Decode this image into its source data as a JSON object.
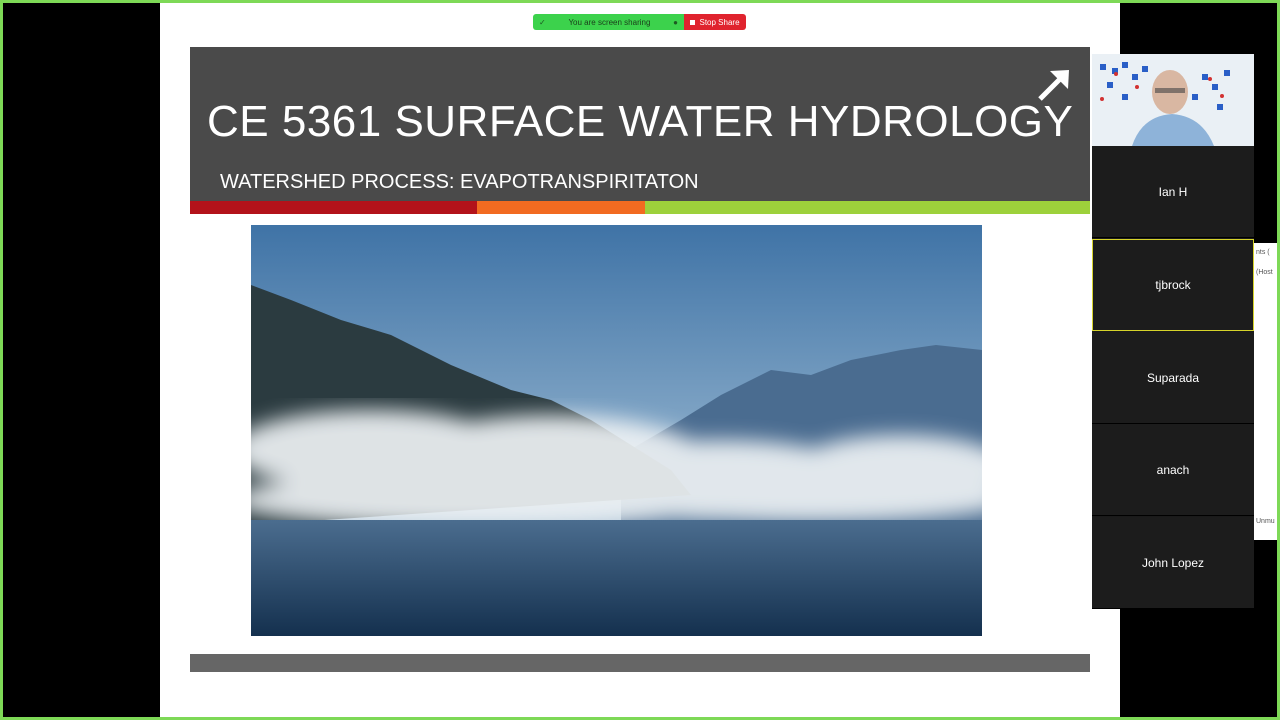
{
  "share_bar": {
    "status_text": "You are screen sharing",
    "stop_label": "Stop Share",
    "status_color": "#3cd24c",
    "stop_color": "#e0232e"
  },
  "slide": {
    "title": "CE 5361 SURFACE WATER HYDROLOGY",
    "subtitle": "WATERSHED PROCESS: EVAPOTRANSPIRITATON",
    "title_bg": "#4a4a4a",
    "accent_colors": [
      "#b3121a",
      "#f26b21",
      "#9dd13b"
    ],
    "photo_alt": "mist rising over a lake with mountains"
  },
  "participants": [
    {
      "name": "Ian H",
      "active": false
    },
    {
      "name": "tjbrock",
      "active": true
    },
    {
      "name": "Suparada",
      "active": false
    },
    {
      "name": "anach",
      "active": false
    },
    {
      "name": "John Lopez",
      "active": false
    }
  ],
  "side_peek": {
    "line1": "nts (",
    "line2": "(Host",
    "line3": "Unmu"
  }
}
